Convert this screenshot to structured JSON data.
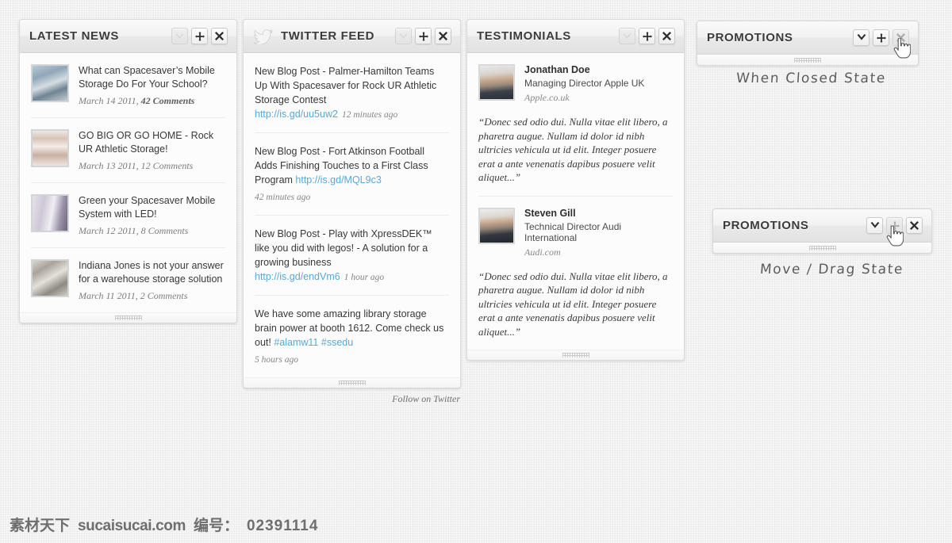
{
  "background": {
    "color": "#f1f1f1"
  },
  "widgets": {
    "latest_news": {
      "title": "LATEST NEWS",
      "buttons": {
        "collapse": "chevron-down",
        "move": "plus",
        "close": "x"
      },
      "items": [
        {
          "title": "What can Spacesaver’s Mobile Storage Do For Your School?",
          "date": "March 14 2011,",
          "comments": "42 Comments"
        },
        {
          "title": "GO BIG OR GO HOME - Rock UR Athletic Storage!",
          "date": "March 13 2011,",
          "comments": "12 Comments"
        },
        {
          "title": "Green your Spacesaver Mobile System with LED!",
          "date": "March 12 2011,",
          "comments": "8 Comments"
        },
        {
          "title": "Indiana Jones is not your answer for a warehouse storage solution",
          "date": "March 11 2011,",
          "comments": "2 Comments"
        }
      ]
    },
    "twitter_feed": {
      "title": "TWITTER FEED",
      "icon": "twitter-bird-icon",
      "follow_label": "Follow on Twitter",
      "items": [
        {
          "text": "New Blog Post - Palmer-Hamilton Teams Up With Spacesaver for Rock UR Athletic Storage Contest ",
          "link": "http://is.gd/uu5uw2",
          "link_inline": false,
          "time": "12 minutes ago"
        },
        {
          "text": "New Blog Post - Fort Atkinson Football Adds Finishing Touches to a First Class Program ",
          "link": "http://is.gd/MQL9c3",
          "link_inline": true,
          "time": "42 minutes ago"
        },
        {
          "text": "New Blog Post - Play with XpressDEK™ like you did with legos! - A solution for a growing business ",
          "link": "http://is.gd/endVm6",
          "link_inline": false,
          "time": "1 hour ago"
        },
        {
          "text": "We have some amazing library storage brain power at booth 1612. Come check us out! ",
          "hashtags": [
            "#alamw11",
            "#ssedu"
          ],
          "time": "5 hours ago"
        }
      ]
    },
    "testimonials": {
      "title": "TESTIMONIALS",
      "items": [
        {
          "name": "Jonathan Doe",
          "role": "Managing Director Apple UK",
          "site": "Apple.co.uk",
          "quote": "“Donec sed odio dui. Nulla vitae elit libero, a pharetra augue. Nullam id dolor id nibh ultricies vehicula ut id elit. Integer posuere erat a ante venenatis dapibus posuere velit aliquet...”"
        },
        {
          "name": "Steven Gill",
          "role": "Technical Director Audi International",
          "site": "Audi.com",
          "quote": "“Donec sed odio dui. Nulla vitae elit libero, a pharetra augue. Nullam id dolor id nibh ultricies vehicula ut id elit. Integer posuere erat a ante venenatis dapibus posuere velit aliquet...”"
        }
      ]
    },
    "promotions_closed": {
      "title": "PROMOTIONS",
      "state_label": "When Closed State",
      "active_button": "close"
    },
    "promotions_drag": {
      "title": "PROMOTIONS",
      "state_label": "Move / Drag State",
      "active_button": "move"
    }
  },
  "watermark": {
    "brand": "素材天下",
    "site": "sucaisucai.com",
    "label": "编号：",
    "number": "02391114"
  }
}
